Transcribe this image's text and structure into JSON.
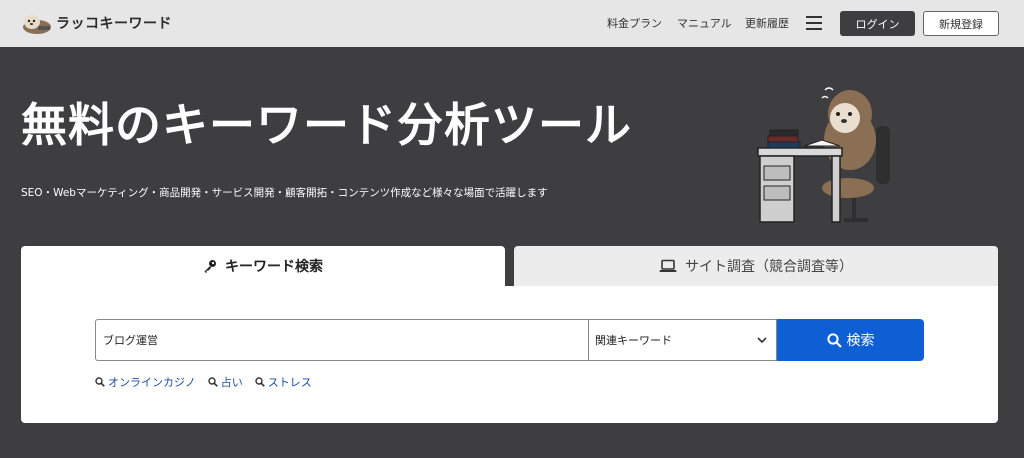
{
  "header": {
    "logo_text": "ラッコキーワード",
    "nav": [
      "料金プラン",
      "マニュアル",
      "更新履歴"
    ],
    "login_label": "ログイン",
    "register_label": "新規登録"
  },
  "hero": {
    "title": "無料のキーワード分析ツール",
    "subtitle": "SEO・Webマーケティング・商品開発・サービス開発・顧客開拓・コンテンツ作成など様々な場面で活躍します"
  },
  "tabs": [
    {
      "label": "キーワード検索",
      "icon": "key-icon",
      "active": true
    },
    {
      "label": "サイト調査（競合調査等）",
      "icon": "laptop-icon",
      "active": false
    }
  ],
  "search": {
    "value": "ブログ運営",
    "mode_selected": "関連キーワード",
    "button_label": "検索"
  },
  "suggestions": [
    "オンラインカジノ",
    "占い",
    "ストレス"
  ],
  "colors": {
    "header_bg": "#e6e6e6",
    "hero_bg": "#3e3e40",
    "accent_blue": "#0e5fd3",
    "link_blue": "#1a4e9e"
  }
}
